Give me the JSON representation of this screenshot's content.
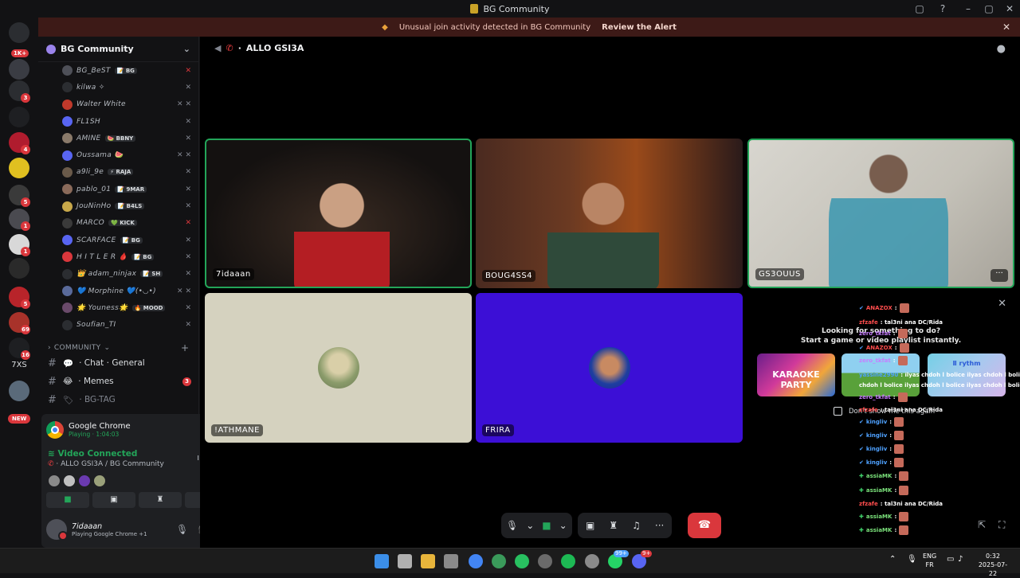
{
  "window": {
    "title": "BG Community"
  },
  "alert": {
    "text": "Unusual join activity detected in BG Community",
    "link": "Review the Alert"
  },
  "rail": {
    "home_badge": "1K+",
    "servers": [
      {
        "color": "#3a3c43",
        "badge": ""
      },
      {
        "color": "#2b2d31",
        "badge": "3"
      },
      {
        "color": "#1e1f22",
        "badge": ""
      },
      {
        "color": "#b01c2e",
        "badge": "4"
      },
      {
        "color": "#e0c020",
        "badge": ""
      },
      {
        "color": "#3a3a3a",
        "badge": "5"
      },
      {
        "color": "#4a4a50",
        "badge": "1"
      },
      {
        "color": "#d8d8d8",
        "badge": "1"
      },
      {
        "color": "#2a2a2a",
        "badge": ""
      },
      {
        "color": "#b8242a",
        "badge": "5"
      },
      {
        "color": "#a8322a",
        "badge": "69"
      },
      {
        "color": "#1e1f22",
        "badge": "16"
      }
    ],
    "text_server": "7XS",
    "new_label": "NEW"
  },
  "sidebar": {
    "guild_name": "BG Community",
    "members": [
      {
        "name": "BG_BeST",
        "tag": "📝 BG",
        "av": "#4e5058",
        "st": "✕",
        "red": true
      },
      {
        "name": "kilwa ✧",
        "tag": "",
        "av": "#2b2d31",
        "st": "✕",
        "red": false
      },
      {
        "name": "Walter White",
        "tag": "",
        "av": "#c0392b",
        "st": "✕ ✕",
        "red": false
      },
      {
        "name": "FL1SH",
        "tag": "",
        "av": "#5865f2",
        "st": "✕",
        "red": false
      },
      {
        "name": "AMINE",
        "tag": "🍉 BBNY",
        "av": "#8a7a6a",
        "st": "✕",
        "red": false
      },
      {
        "name": "Oussama 🍉",
        "tag": "",
        "av": "#5865f2",
        "st": "✕ ✕",
        "red": false
      },
      {
        "name": "a9li_9e",
        "tag": "⚡ RAJA",
        "av": "#6a5a4a",
        "st": "✕",
        "red": false
      },
      {
        "name": "pablo_01",
        "tag": "📝 9MAR",
        "av": "#8a6a5a",
        "st": "✕",
        "red": false
      },
      {
        "name": "JouNinHo",
        "tag": "📝 B4LS",
        "av": "#c8a84a",
        "st": "✕",
        "red": false
      },
      {
        "name": "MARCO",
        "tag": "💚 KICK",
        "av": "#3a3a3a",
        "st": "✕",
        "red": true
      },
      {
        "name": "SCARFACE",
        "tag": "📝 BG",
        "av": "#5865f2",
        "st": "✕",
        "red": false
      },
      {
        "name": "H I T L E R 🩸",
        "tag": "📝 BG",
        "av": "#da373c",
        "st": "✕",
        "red": false
      },
      {
        "name": "👑 adam_ninjax",
        "tag": "📝 SH",
        "av": "#2b2d31",
        "st": "✕",
        "red": false
      },
      {
        "name": "💙 Morphine 💙(•◡•)",
        "tag": "",
        "av": "#5a6a9a",
        "st": "✕ ✕",
        "red": false
      },
      {
        "name": "🌟 Youness🌟",
        "tag": "🔥 MOOD",
        "av": "#6a4a6a",
        "st": "✕",
        "red": false
      },
      {
        "name": "Soufian_TI",
        "tag": "",
        "av": "#2b2d31",
        "st": "✕",
        "red": false
      }
    ],
    "category": "COMMUNITY",
    "channels": [
      {
        "emoji": "💬",
        "name": "Chat · General",
        "badge": "",
        "muted": false
      },
      {
        "emoji": "😂",
        "name": "Memes",
        "badge": "3",
        "muted": false
      },
      {
        "emoji": "🏷",
        "name": "BG-TAG",
        "badge": "",
        "muted": true
      }
    ]
  },
  "panel": {
    "activity_name": "Google Chrome",
    "activity_sub": "Playing · 1:04:03",
    "vc_status": "Video Connected",
    "vc_channel": "ALLO GSI3A / BG Community",
    "user_name": "7idaaan",
    "user_sub": "Playing Google Chrome +1"
  },
  "stage": {
    "channel": "ALLO GSI3A",
    "tiles": [
      {
        "label": "7idaaan"
      },
      {
        "label": "BOUG4SS4"
      },
      {
        "label": "GS3OUUS"
      },
      {
        "label": "!ATHMANE"
      },
      {
        "label": "FRIRA"
      }
    ],
    "activity": {
      "title_line1": "Looking for something to do?",
      "title_line2": "Start a game or video playlist instantly.",
      "games": [
        {
          "label": "KARAOKE PARTY"
        },
        {
          "label": ""
        },
        {
          "label": "Ⅱ rythm"
        }
      ],
      "dont_show": "Don't show me this again"
    },
    "chat": [
      {
        "ic": "✔",
        "icg": false,
        "user": "ANAZOX",
        "uc": "r",
        "msg": ":",
        "emb": true
      },
      {
        "ic": "",
        "icg": false,
        "user": "zfzafe",
        "uc": "r",
        "msg": ": tal3ni ana DC/Rida",
        "emb": false
      },
      {
        "ic": "",
        "icg": false,
        "user": "zero_tkfat",
        "uc": "p",
        "msg": ":",
        "emb": true
      },
      {
        "ic": "✔",
        "icg": false,
        "user": "ANAZOX",
        "uc": "r",
        "msg": ":",
        "emb": true
      },
      {
        "ic": "",
        "icg": false,
        "user": "zero_tkfat",
        "uc": "p",
        "msg": ":",
        "emb": true
      },
      {
        "ic": "",
        "icg": false,
        "user": "yassine2990",
        "uc": "",
        "msg": ": ilyas chdoh l bolice ilyas chdoh l bolice ilyas",
        "emb": false
      },
      {
        "ic": "",
        "icg": false,
        "user": "",
        "uc": "",
        "msg": "chdoh l bolice ilyas chdoh l bolice ilyas chdoh l bolice",
        "emb": false
      },
      {
        "ic": "",
        "icg": false,
        "user": "zero_tkfat",
        "uc": "p",
        "msg": ":",
        "emb": true
      },
      {
        "ic": "",
        "icg": false,
        "user": "zfzafe",
        "uc": "r",
        "msg": ": tal3ni ana DC/Rida",
        "emb": false
      },
      {
        "ic": "✔",
        "icg": false,
        "user": "kingliv",
        "uc": "",
        "msg": ":",
        "emb": true
      },
      {
        "ic": "✔",
        "icg": false,
        "user": "kingliv",
        "uc": "",
        "msg": ":",
        "emb": true
      },
      {
        "ic": "✔",
        "icg": false,
        "user": "kingliv",
        "uc": "",
        "msg": ":",
        "emb": true
      },
      {
        "ic": "✔",
        "icg": false,
        "user": "kingliv",
        "uc": "",
        "msg": ":",
        "emb": true
      },
      {
        "ic": "✚",
        "icg": true,
        "user": "assiaMK",
        "uc": "g",
        "msg": ":",
        "emb": true
      },
      {
        "ic": "✚",
        "icg": true,
        "user": "assiaMK",
        "uc": "g",
        "msg": ":",
        "emb": true
      },
      {
        "ic": "",
        "icg": false,
        "user": "zfzafe",
        "uc": "r",
        "msg": ": tal3ni ana DC/Rida",
        "emb": false
      },
      {
        "ic": "✚",
        "icg": true,
        "user": "assiaMK",
        "uc": "g",
        "msg": ":",
        "emb": true
      },
      {
        "ic": "✚",
        "icg": true,
        "user": "assiaMK",
        "uc": "g",
        "msg": ":",
        "emb": true
      }
    ]
  },
  "taskbar": {
    "apps": [
      {
        "color": "#3b8ee8"
      },
      {
        "color": "#b0b0b0"
      },
      {
        "color": "#e8b53b"
      },
      {
        "color": "#8a8a8a"
      },
      {
        "color": "#4285f4"
      },
      {
        "color": "#3a9a5a"
      },
      {
        "color": "#28c060"
      },
      {
        "color": "#6a6a6a"
      },
      {
        "color": "#1db954"
      },
      {
        "color": "#8a8a8a"
      },
      {
        "color": "#25d366"
      },
      {
        "color": "#5865f2"
      }
    ],
    "lang": "ENG",
    "region": "FR",
    "time": "0:32",
    "date": "2025-07-22",
    "whatsapp_badge": "99+",
    "discord_badge": "9+"
  },
  "colors": {
    "accent": "#5865f2",
    "speaking": "#23a559",
    "danger": "#da373c"
  }
}
